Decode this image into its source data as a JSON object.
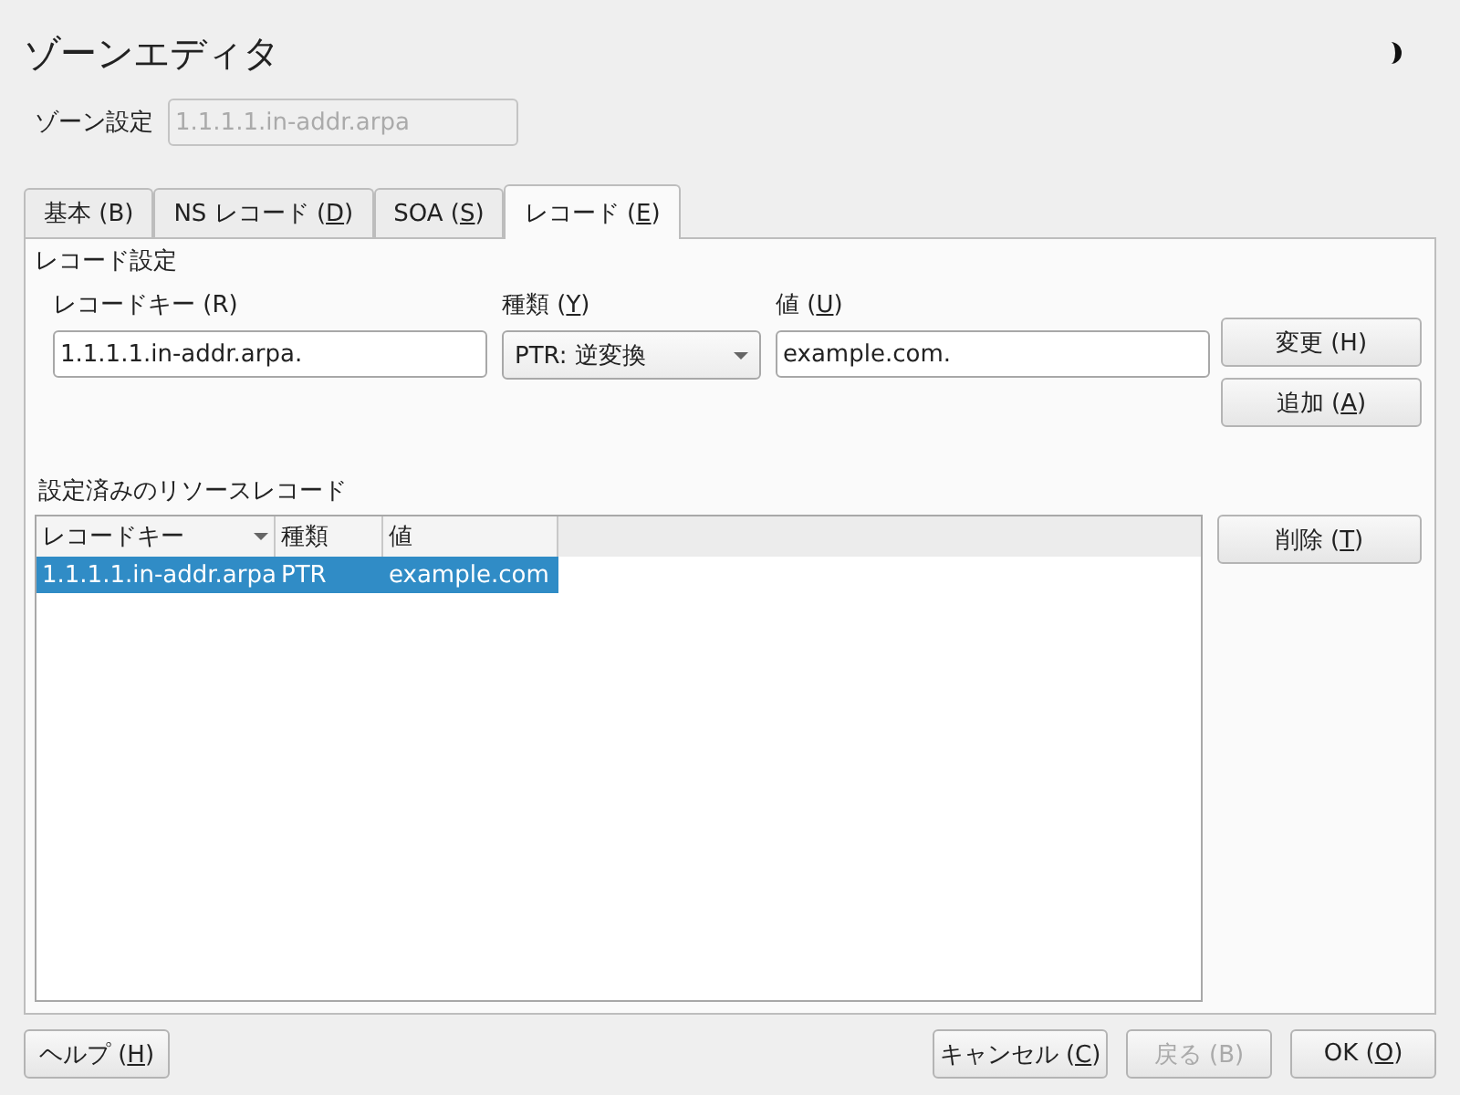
{
  "window": {
    "title": "ゾーンエディタ"
  },
  "zone": {
    "label": "ゾーン設定",
    "value": "1.1.1.1.in-addr.arpa",
    "disabled": true
  },
  "tabs": [
    {
      "label": {
        "pre": "基本 (B)"
      },
      "selected": false
    },
    {
      "label": {
        "pre": "NS レコード (",
        "key": "D",
        "post": ")"
      },
      "selected": false
    },
    {
      "label": {
        "pre": "SOA (",
        "key": "S",
        "post": ")"
      },
      "selected": false
    },
    {
      "label": {
        "pre": "レコード (",
        "key": "E",
        "post": ")"
      },
      "selected": true
    }
  ],
  "record_settings": {
    "title": "レコード設定",
    "key_field": {
      "label": {
        "pre": "レコードキー (R)"
      },
      "value": "1.1.1.1.in-addr.arpa."
    },
    "type_field": {
      "label": {
        "pre": "種類 (",
        "key": "Y",
        "post": ")"
      },
      "value": "PTR: 逆変換"
    },
    "value_field": {
      "label": {
        "pre": "値 (",
        "key": "U",
        "post": ")"
      },
      "value": "example.com."
    },
    "buttons": [
      {
        "label": {
          "pre": "変更 (H)"
        },
        "disabled": false
      },
      {
        "label": {
          "pre": "追加 (",
          "key": "A",
          "post": ")"
        },
        "disabled": false
      }
    ]
  },
  "resource_records": {
    "title": "設定済みのリソースレコード",
    "columns": [
      "レコードキー",
      "種類",
      "値"
    ],
    "rows": [
      {
        "cells": [
          "1.1.1.1.in-addr.arpa",
          "PTR",
          "example.com"
        ],
        "selected": true
      }
    ],
    "buttons": [
      {
        "label": {
          "pre": "削除 (",
          "key": "T",
          "post": ")"
        },
        "disabled": false
      }
    ]
  },
  "footer": {
    "left": [
      {
        "label": {
          "pre": "ヘルプ (",
          "key": "H",
          "post": ")"
        },
        "disabled": false
      }
    ],
    "right": [
      {
        "label": {
          "pre": "キャンセル (",
          "key": "C",
          "post": ")"
        },
        "disabled": false
      },
      {
        "label": {
          "pre": "戻る (B)"
        },
        "disabled": true
      },
      {
        "label": {
          "pre": "OK (",
          "key": "O",
          "post": ")"
        },
        "disabled": false
      }
    ]
  }
}
